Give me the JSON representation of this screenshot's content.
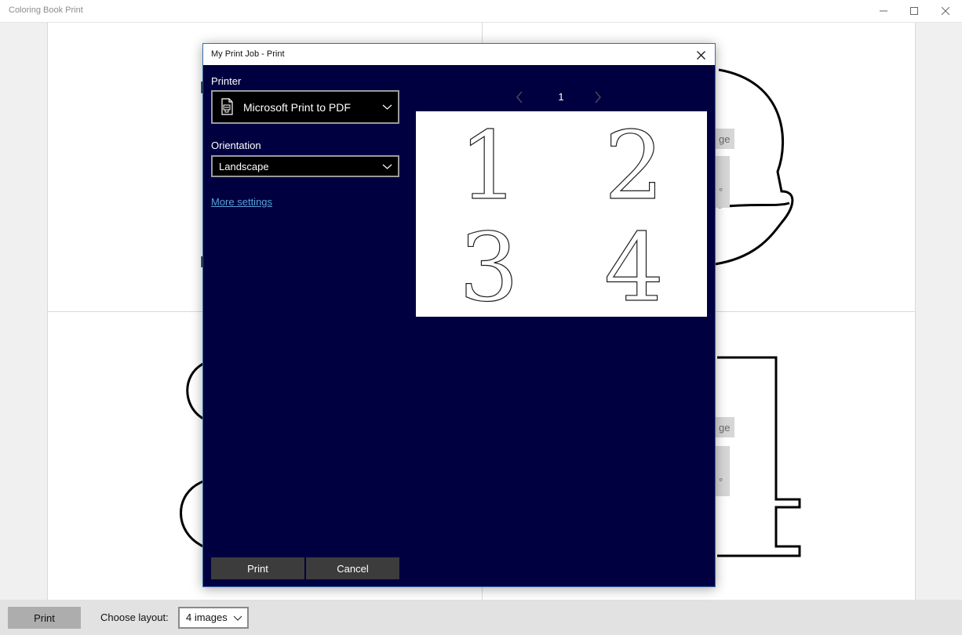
{
  "window": {
    "title": "Coloring Book Print"
  },
  "background_page": {
    "ghost_chip_1": "ge",
    "ghost_chip_2": "ge",
    "ghost_degree_1": "°",
    "ghost_degree_2": "°"
  },
  "bottom_bar": {
    "print_label": "Print",
    "layout_label": "Choose layout:",
    "layout_value": "4 images"
  },
  "dialog": {
    "title": "My Print Job - Print",
    "printer_label": "Printer",
    "printer_value": "Microsoft Print to PDF",
    "orientation_label": "Orientation",
    "orientation_value": "Landscape",
    "more_settings": "More settings",
    "page_number": "1",
    "preview_digits": [
      "1",
      "2",
      "3",
      "4"
    ],
    "print_button": "Print",
    "cancel_button": "Cancel"
  },
  "icons": {
    "minimize": "minimize-icon",
    "maximize": "maximize-icon",
    "close": "close-icon",
    "pdf": "pdf-printer-icon",
    "chevron": "chevron-down-icon",
    "prev": "chevron-left-icon",
    "next": "chevron-right-icon"
  },
  "colors": {
    "dialog_background": "#000040",
    "link": "#5a9fd6",
    "button": "#3c3c3c"
  }
}
